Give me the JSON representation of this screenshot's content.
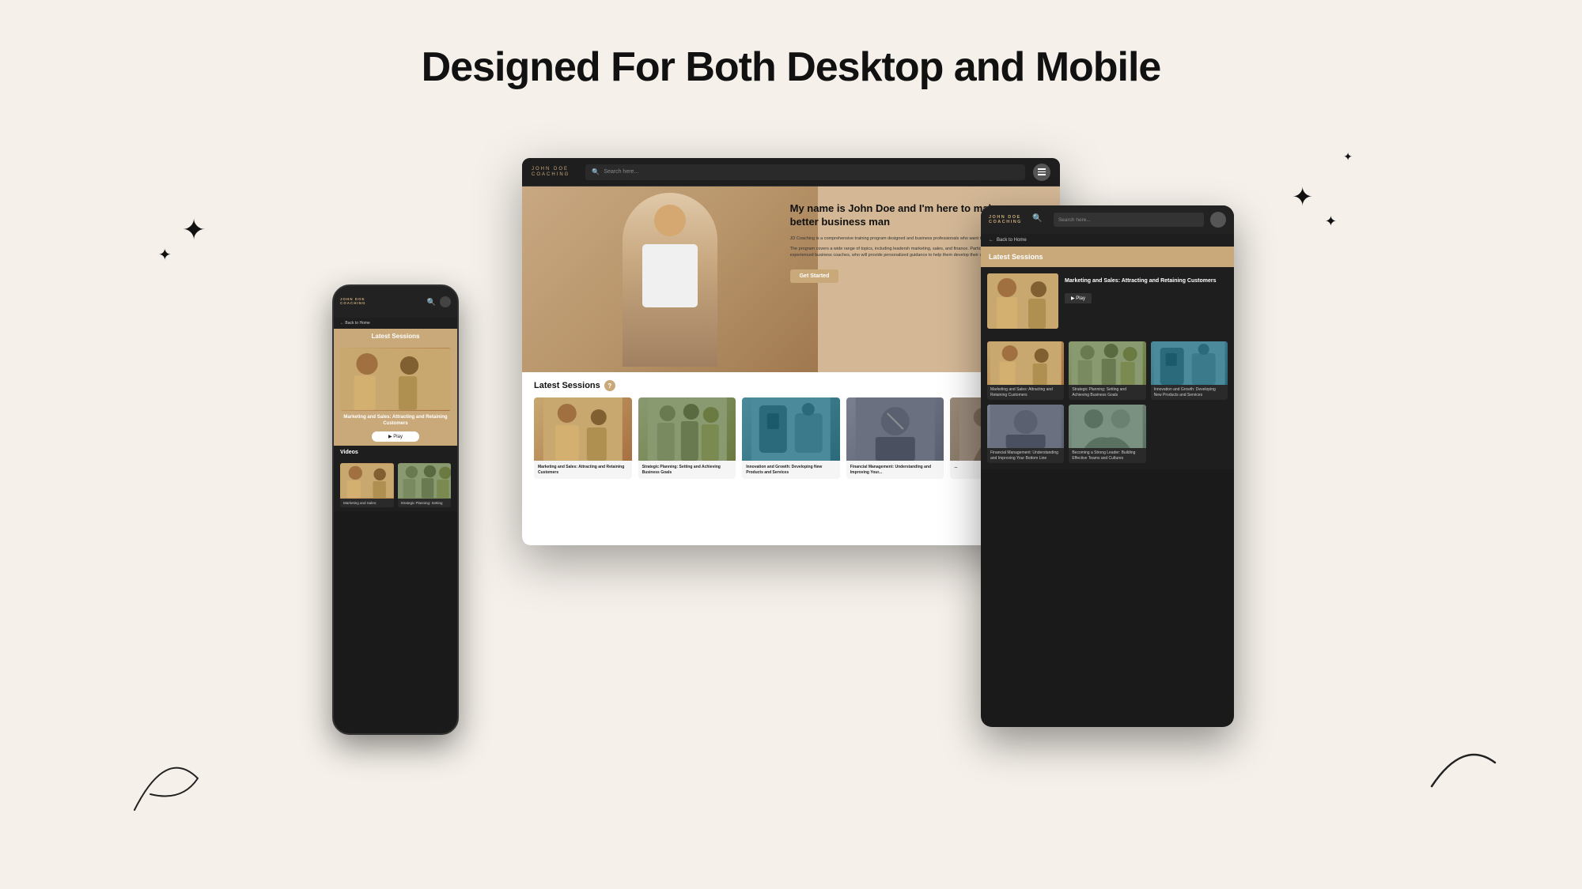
{
  "page": {
    "heading": "Designed For Both Desktop and Mobile",
    "bg_color": "#f5f0ea"
  },
  "desktop": {
    "brand_name": "JOHN DOE",
    "brand_sub": "COACHING",
    "search_placeholder": "Search here...",
    "hero_title": "My name is John Doe and I'm here to make you a better business man",
    "hero_desc1": "JD Coaching is a comprehensive training program designed and business professionals who want to achieve success i",
    "hero_desc2": "The program covers a wide range of topics, including leadersh marketing, sales, and finance. Participants will receive hands- experienced business coaches, who will provide personalized guidance to help them develop their skills and grow their busi",
    "cta_button": "Get Started",
    "sessions_title": "Latest Sessions",
    "sessions": [
      {
        "label": "Marketing and Sales: Attracting and Retaining Customers"
      },
      {
        "label": "Strategic Planning: Setting and Achieving Business Goals"
      },
      {
        "label": "Innovation and Growth: Developing New Products and Services"
      },
      {
        "label": "Financial Management: Understanding and Improving Your..."
      },
      {
        "label": "..."
      }
    ]
  },
  "tablet": {
    "brand_name": "JOHN DOE",
    "brand_sub": "COACHING",
    "search_placeholder": "Search here...",
    "back_label": "Back to Home",
    "sessions_title": "Latest Sessions",
    "featured_title": "Marketing and Sales: Attracting and Retaining Customers",
    "play_label": "▶ Play",
    "grid_items": [
      {
        "label": "Marketing and Sales: Attracting and Retaining Customers"
      },
      {
        "label": "Strategic Planning: Setting and Achieving Business Goals"
      },
      {
        "label": "Innovation and Growth: Developing New Products and Services"
      },
      {
        "label": "Financial Management: Understanding and Improving Your Bottom Line"
      },
      {
        "label": "Becoming a Strong Leader: Building Effective Teams and Cultures"
      }
    ]
  },
  "mobile": {
    "brand_name": "JOHN DOE",
    "brand_sub": "COACHING",
    "back_label": "Back to Home",
    "sessions_title": "Latest Sessions",
    "featured_title": "Marketing and Sales: Attracting and Retaining Customers",
    "play_label": "▶ Play",
    "videos_title": "Videos",
    "video_items": [
      {
        "label": "Marketing and Sales:"
      },
      {
        "label": "Strategic Planning: Setting"
      }
    ]
  },
  "icons": {
    "search": "🔍",
    "menu": "☰",
    "back_arrow": "←",
    "play": "▶",
    "star": "✦"
  }
}
